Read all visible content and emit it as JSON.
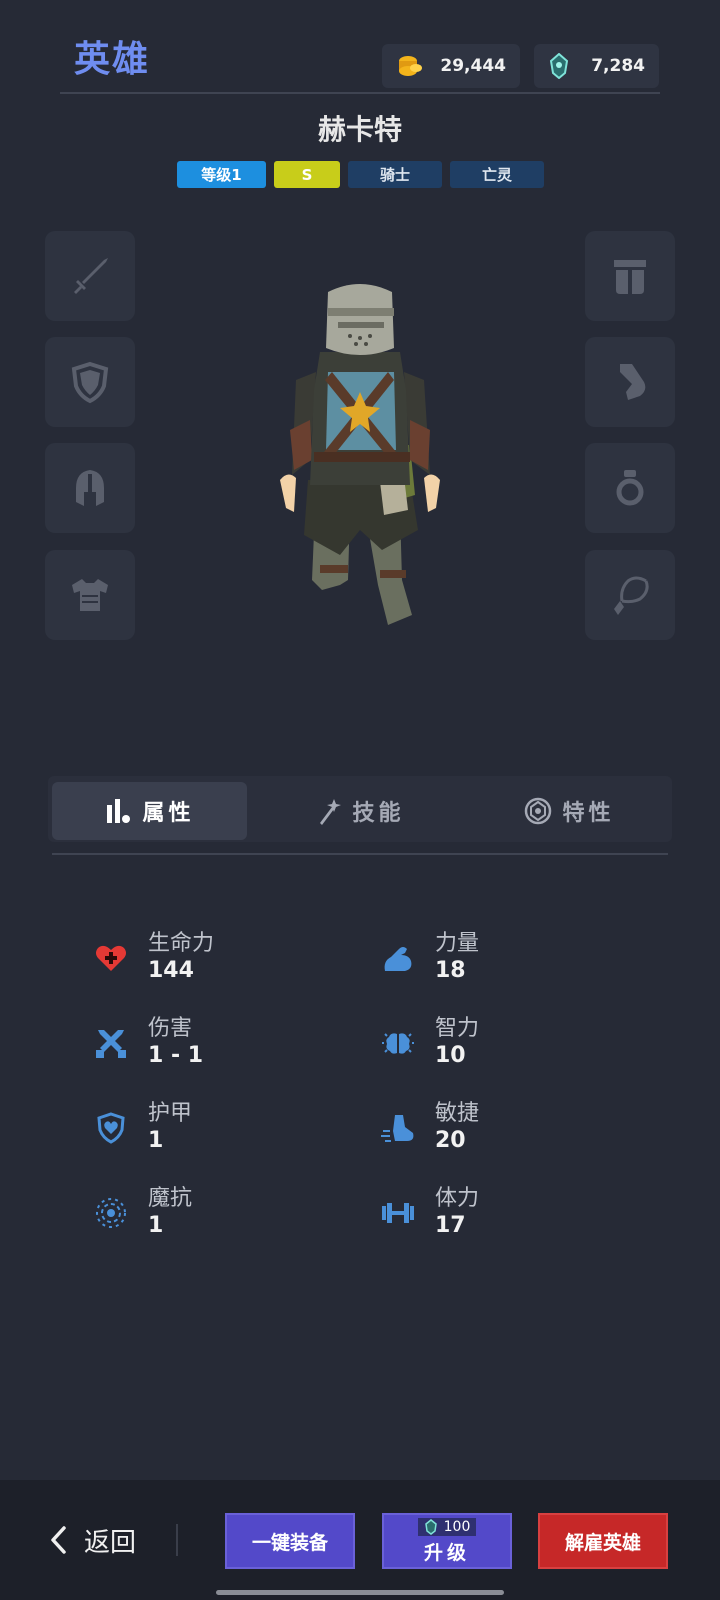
{
  "header": {
    "title": "英雄",
    "gold": "29,444",
    "gems": "7,284"
  },
  "hero": {
    "name": "赫卡特",
    "tags": {
      "level": "等级1",
      "rank": "S",
      "class": "骑士",
      "race": "亡灵"
    }
  },
  "equipment_slots": {
    "left": [
      "weapon",
      "shield",
      "helmet",
      "chest-armor"
    ],
    "right": [
      "pants",
      "boots",
      "ring",
      "amulet"
    ]
  },
  "tabs": [
    {
      "label": "属性",
      "icon": "bar-chart-icon",
      "active": true
    },
    {
      "label": "技能",
      "icon": "magic-wand-icon",
      "active": false
    },
    {
      "label": "特性",
      "icon": "trait-emblem-icon",
      "active": false
    }
  ],
  "stats": {
    "hp": {
      "label": "生命力",
      "value": "144"
    },
    "damage": {
      "label": "伤害",
      "value": "1 - 1"
    },
    "armor": {
      "label": "护甲",
      "value": "1"
    },
    "magic_resist": {
      "label": "魔抗",
      "value": "1"
    },
    "strength": {
      "label": "力量",
      "value": "18"
    },
    "intellect": {
      "label": "智力",
      "value": "10"
    },
    "agility": {
      "label": "敏捷",
      "value": "20"
    },
    "stamina": {
      "label": "体力",
      "value": "17"
    }
  },
  "bottom": {
    "back_label": "返回",
    "equip_all_label": "一键装备",
    "upgrade_label": "升级",
    "upgrade_cost": "100",
    "fire_label": "解雇英雄"
  },
  "colors": {
    "background": "#262a36",
    "title_accent": "#6f8df0",
    "stat_icon_blue": "#4a90d9",
    "hp_red": "#e53935",
    "button_purple": "#5349c9",
    "button_red": "#c62828"
  }
}
